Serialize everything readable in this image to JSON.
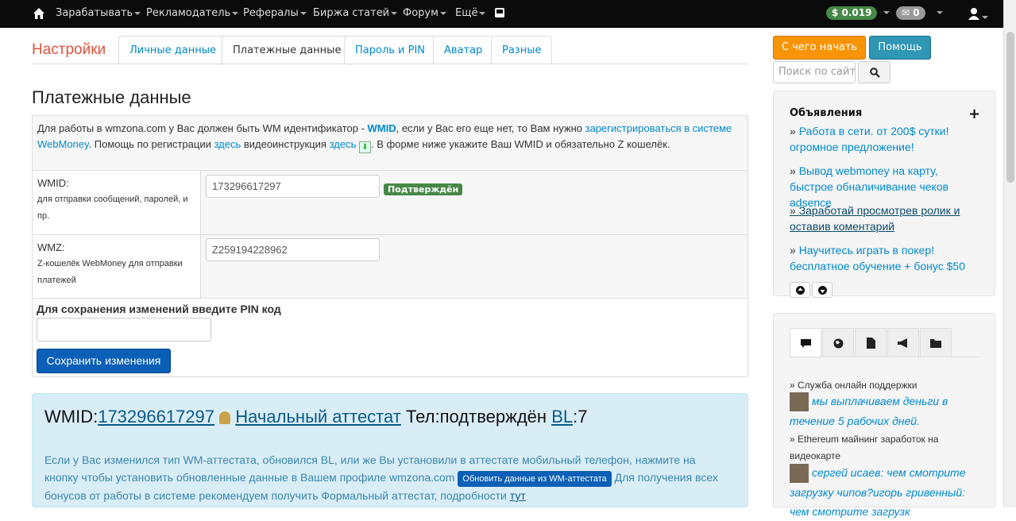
{
  "nav": {
    "items": [
      "Зарабатывать",
      "Рекламодатель",
      "Рефералы",
      "Биржа статей",
      "Форум",
      "Ещё"
    ],
    "balance": "$ 0.019",
    "messages": "0"
  },
  "page": {
    "title": "Настройки",
    "tabs": [
      "Личные данные",
      "Платежные данные",
      "Пароль и PIN",
      "Аватар",
      "Разные"
    ],
    "heading": "Платежные данные"
  },
  "intro": {
    "p1": "Для работы в wmzona.com у Вас должен быть WM идентификатор - ",
    "wmid": "WMID",
    "p2": ", если у Вас его еще нет, то Вам нужно ",
    "reg_link": "зарегистрироваться в системе WebMoney",
    "p3": ". Помощь по регистрации ",
    "here1": "здесь",
    "p4": " видеоинструкция ",
    "here2": "здесь",
    "p5": ". В форме ниже укажите Ваш WMID и обязательно Z кошелёк."
  },
  "form": {
    "wmid_label": "WMID:",
    "wmid_hint": "для отправки сообщений, паролей, и пр.",
    "wmid_value": "173296617297",
    "wmid_status": "Подтверждён",
    "wmz_label": "WMZ:",
    "wmz_hint": "Z-кошелёк WebMoney для отправки платежей",
    "wmz_value": "Z259194228962",
    "pin_label": "Для сохранения изменений введите PIN код",
    "save": "Сохранить изменения"
  },
  "wminfo": {
    "wmid_prefix": "WMID:",
    "wmid": "173296617297",
    "attestat": "Начальный аттестат",
    "phone": "Тел:подтверждён",
    "bl": "BL",
    "bl_value": ":7",
    "text1": "Если у Вас изменился тип WM-аттестата, обновился BL, или же Вы установили в аттестате мобильный телефон, нажмите на кнопку чтобы установить обновленные данные в Вашем профиле wmzona.com ",
    "btn": "Обновить данные из WM-аттестата",
    "text2": " Для получения всех бонусов от работы в системе рекомендуем получить Формальный аттестат, подробности ",
    "link": "тут"
  },
  "sidebar": {
    "start": "С чего начать",
    "help": "Помощь",
    "search_placeholder": "Поиск по сайту",
    "ads_title": "Объявления",
    "ads": [
      "Работа в сети. от 200$ сутки! огромное предложение!",
      "Вывод webmoney на карту, быстрое обналичивание чеков adsence",
      "Заработай просмотрев ролик и оставив коментарий",
      "Научитесь играть в покер! бесплатное обучение + бонус $50"
    ],
    "chat": [
      {
        "title": "Служба онлайн поддержки",
        "msg": "мы выплачиваем деньги в течение 5 рабочих дней."
      },
      {
        "title": "Ethereum майнинг заработок на видеокарте",
        "msg": "сергей исаев: чем смотрите загрузку чипов?игорь гривенный: чем смотрите загрузк"
      }
    ]
  }
}
